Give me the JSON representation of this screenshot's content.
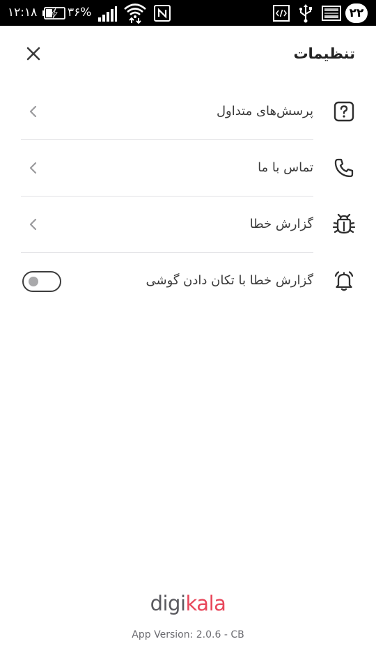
{
  "status_bar": {
    "time": "۱۲:۱۸",
    "battery_percent": "۳۶%",
    "battery_level": 0.36,
    "notification_count": "۲۲",
    "icons": [
      "battery-charging-icon",
      "cell-signal-icon",
      "wifi-icon",
      "nfc-icon",
      "developer-mode-icon",
      "usb-icon",
      "image-notification-icon"
    ]
  },
  "header": {
    "title": "تنظیمات",
    "close_icon": "close-icon"
  },
  "menu": [
    {
      "label": "پرسش‌های متداول",
      "icon": "question-icon",
      "action": "chevron"
    },
    {
      "label": "تماس با ما",
      "icon": "phone-icon",
      "action": "chevron"
    },
    {
      "label": "گزارش خطا",
      "icon": "bug-icon",
      "action": "chevron"
    },
    {
      "label": "گزارش خطا با تکان دادن گوشی",
      "icon": "bell-icon",
      "action": "toggle",
      "enabled": false
    }
  ],
  "footer": {
    "logo_part1": "digi",
    "logo_part2": "kala",
    "version": "App Version: 2.0.6 - CB"
  },
  "colors": {
    "brand_gray": "#5a5a5f",
    "brand_red": "#e8475b",
    "text": "#3a3a3a",
    "divider": "#e3e3e6"
  }
}
